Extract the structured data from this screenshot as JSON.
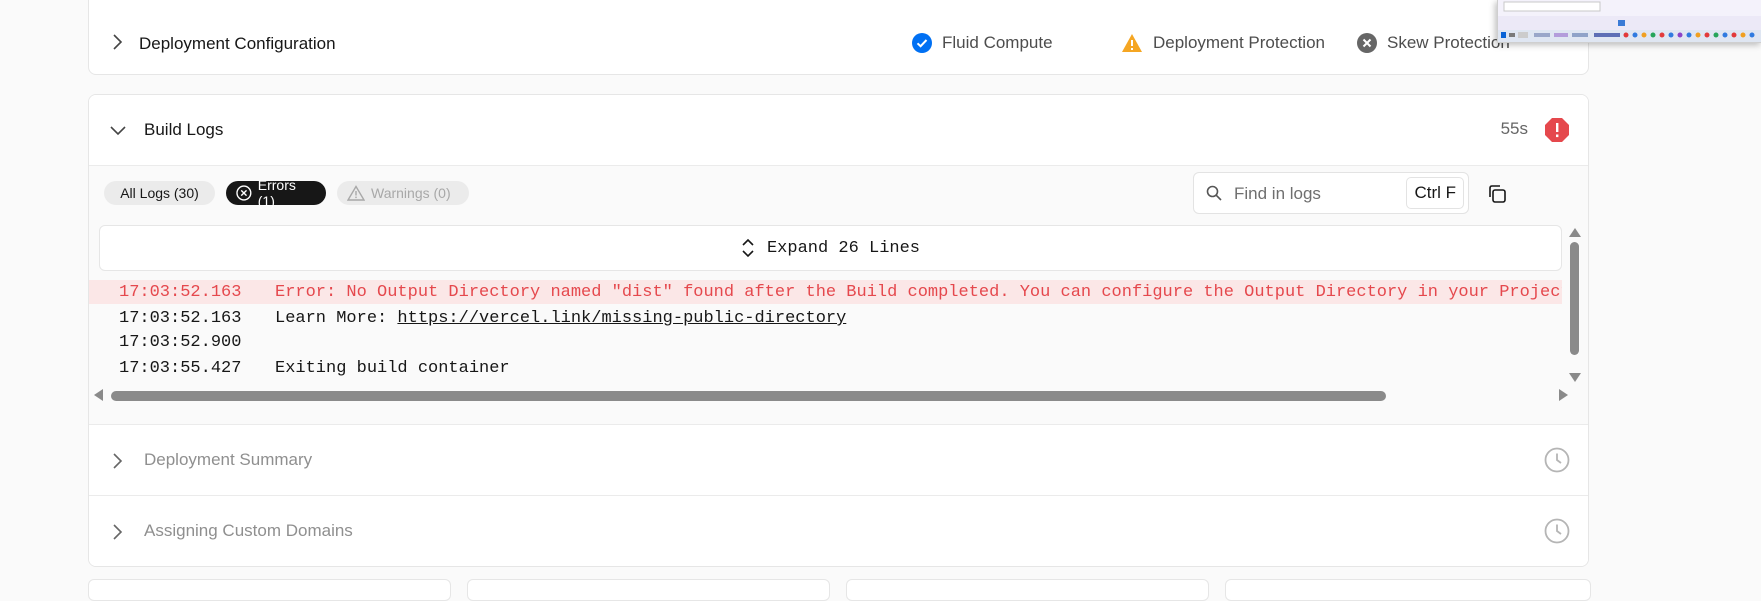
{
  "deployment_config": {
    "title": "Deployment Configuration",
    "features": [
      {
        "label": "Fluid Compute",
        "icon": "check-circle-icon",
        "color": "#0070f3"
      },
      {
        "label": "Deployment Protection",
        "icon": "warning-triangle-icon",
        "color": "#f5a623"
      },
      {
        "label": "Skew Protection",
        "icon": "x-circle-icon",
        "color": "#666666"
      }
    ]
  },
  "build_logs": {
    "title": "Build Logs",
    "duration": "55s",
    "status_icon": "error-stop-icon",
    "status_color": "#e5484d",
    "filters": {
      "all": "All Logs (30)",
      "errors": "Errors (1)",
      "warnings": "Warnings (0)"
    },
    "search": {
      "placeholder": "Find in logs",
      "shortcut": "Ctrl F"
    },
    "expand_label": "Expand 26 Lines",
    "lines": [
      {
        "time": "17:03:52.163",
        "text": "Error: No Output Directory named \"dist\" found after the Build completed. You can configure the Output Directory in your Project Settings.",
        "level": "error"
      },
      {
        "time": "17:03:52.163",
        "text": "Learn More: ",
        "link": "https://vercel.link/missing-public-directory"
      },
      {
        "time": "17:03:52.900",
        "text": ""
      },
      {
        "time": "17:03:55.427",
        "text": "Exiting build container"
      }
    ]
  },
  "sections": [
    {
      "title": "Deployment Summary",
      "icon": "clock-icon"
    },
    {
      "title": "Assigning Custom Domains",
      "icon": "clock-icon"
    }
  ]
}
